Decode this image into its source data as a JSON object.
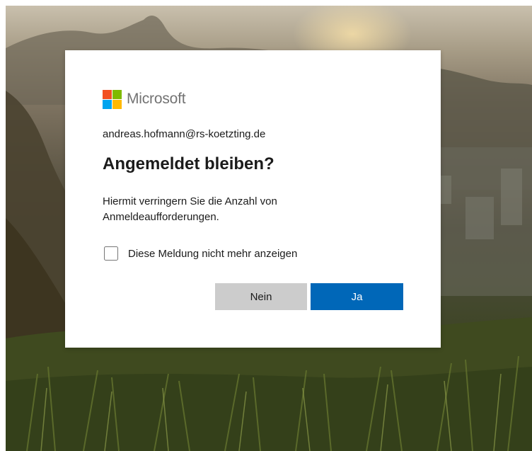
{
  "theme": {
    "accent": "#0067b8",
    "secondary_button": "#cccccc",
    "text": "#1b1b1b",
    "brand_text": "#737373",
    "logo_colors": [
      "#f25022",
      "#7fba00",
      "#00a4ef",
      "#ffb900"
    ]
  },
  "dialog": {
    "brand": "Microsoft",
    "account": "andreas.hofmann@rs-koetzting.de",
    "title": "Angemeldet bleiben?",
    "description": "Hiermit verringern Sie die Anzahl von Anmeldeaufforderungen.",
    "checkbox": {
      "label": "Diese Meldung nicht mehr anzeigen",
      "checked": false
    },
    "buttons": {
      "no_label": "Nein",
      "yes_label": "Ja"
    }
  }
}
